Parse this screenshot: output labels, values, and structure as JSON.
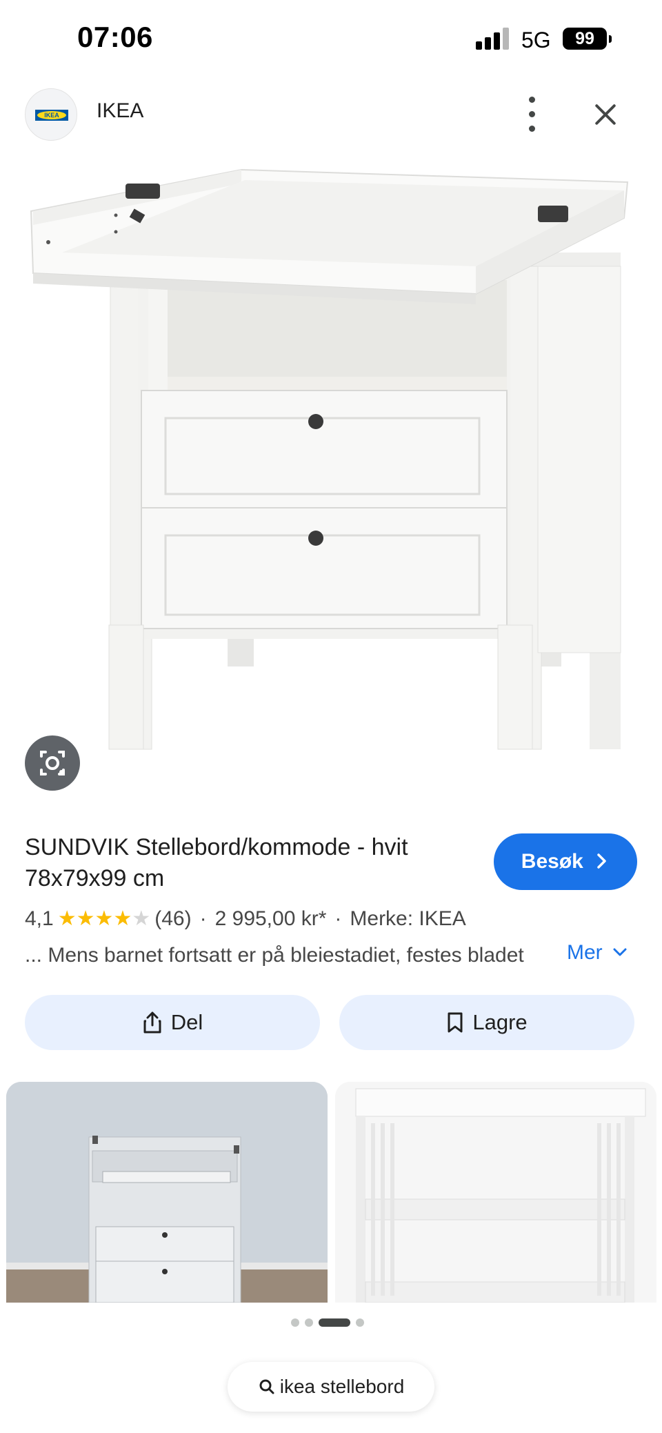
{
  "status_bar": {
    "time": "07:06",
    "network": "5G",
    "battery": "99"
  },
  "header": {
    "site_name": "IKEA",
    "logo_text": "IKEA"
  },
  "product": {
    "title": "SUNDVIK Stellebord/kommode - hvit 78x79x99 cm",
    "visit_label": "Besøk",
    "rating": "4,1",
    "rating_value": 4.1,
    "rating_max": 5,
    "review_count": "(46)",
    "price": "2 995,00 kr*",
    "brand": "Merke: IKEA",
    "description": "... Mens barnet fortsatt er på bleiestadiet, festes bladet",
    "more_label": "Mer"
  },
  "actions": {
    "share_label": "Del",
    "save_label": "Lagre"
  },
  "carousel": {
    "page_count": 4,
    "active_index": 2
  },
  "search": {
    "query": "ikea stellebord"
  },
  "colors": {
    "accent": "#1a73e8",
    "chip_bg": "#e8f0fe",
    "star": "#fbbc04"
  }
}
